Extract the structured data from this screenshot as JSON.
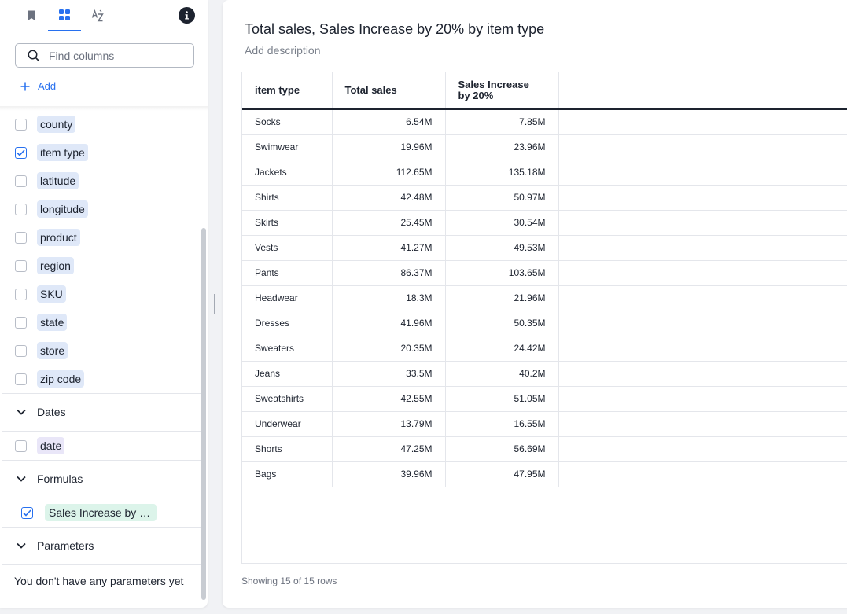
{
  "tabs": [
    {
      "name": "bookmark",
      "active": false
    },
    {
      "name": "columns",
      "active": true
    },
    {
      "name": "sort-az",
      "active": false
    }
  ],
  "sidebar": {
    "search_placeholder": "Find columns",
    "add_label": "Add",
    "columns": [
      {
        "label": "county",
        "checked": false
      },
      {
        "label": "item type",
        "checked": true
      },
      {
        "label": "latitude",
        "checked": false
      },
      {
        "label": "longitude",
        "checked": false
      },
      {
        "label": "product",
        "checked": false
      },
      {
        "label": "region",
        "checked": false
      },
      {
        "label": "SKU",
        "checked": false
      },
      {
        "label": "state",
        "checked": false
      },
      {
        "label": "store",
        "checked": false
      },
      {
        "label": "zip code",
        "checked": false
      }
    ],
    "dates": {
      "title": "Dates",
      "items": [
        {
          "label": "date",
          "checked": false
        }
      ]
    },
    "formulas": {
      "title": "Formulas",
      "items": [
        {
          "label": "Sales Increase by …",
          "checked": true
        }
      ]
    },
    "parameters": {
      "title": "Parameters",
      "empty_text": "You don't have any parameters yet"
    }
  },
  "main": {
    "title": "Total sales, Sales Increase by 20% by item type",
    "description_placeholder": "Add description",
    "table": {
      "headers": [
        "item type",
        "Total sales",
        "Sales Increase by 20%"
      ],
      "rows": [
        [
          "Socks",
          "6.54M",
          "7.85M"
        ],
        [
          "Swimwear",
          "19.96M",
          "23.96M"
        ],
        [
          "Jackets",
          "112.65M",
          "135.18M"
        ],
        [
          "Shirts",
          "42.48M",
          "50.97M"
        ],
        [
          "Skirts",
          "25.45M",
          "30.54M"
        ],
        [
          "Vests",
          "41.27M",
          "49.53M"
        ],
        [
          "Pants",
          "86.37M",
          "103.65M"
        ],
        [
          "Headwear",
          "18.3M",
          "21.96M"
        ],
        [
          "Dresses",
          "41.96M",
          "50.35M"
        ],
        [
          "Sweaters",
          "20.35M",
          "24.42M"
        ],
        [
          "Jeans",
          "33.5M",
          "40.2M"
        ],
        [
          "Sweatshirts",
          "42.55M",
          "51.05M"
        ],
        [
          "Underwear",
          "13.79M",
          "16.55M"
        ],
        [
          "Shorts",
          "47.25M",
          "56.69M"
        ],
        [
          "Bags",
          "39.96M",
          "47.95M"
        ]
      ]
    },
    "footer": "Showing 15 of 15 rows"
  },
  "colors": {
    "accent": "#2770ef",
    "attribute_chip": "#dfe8f8",
    "date_chip": "#e9e6f8",
    "formula_chip": "#dcf4ea"
  }
}
